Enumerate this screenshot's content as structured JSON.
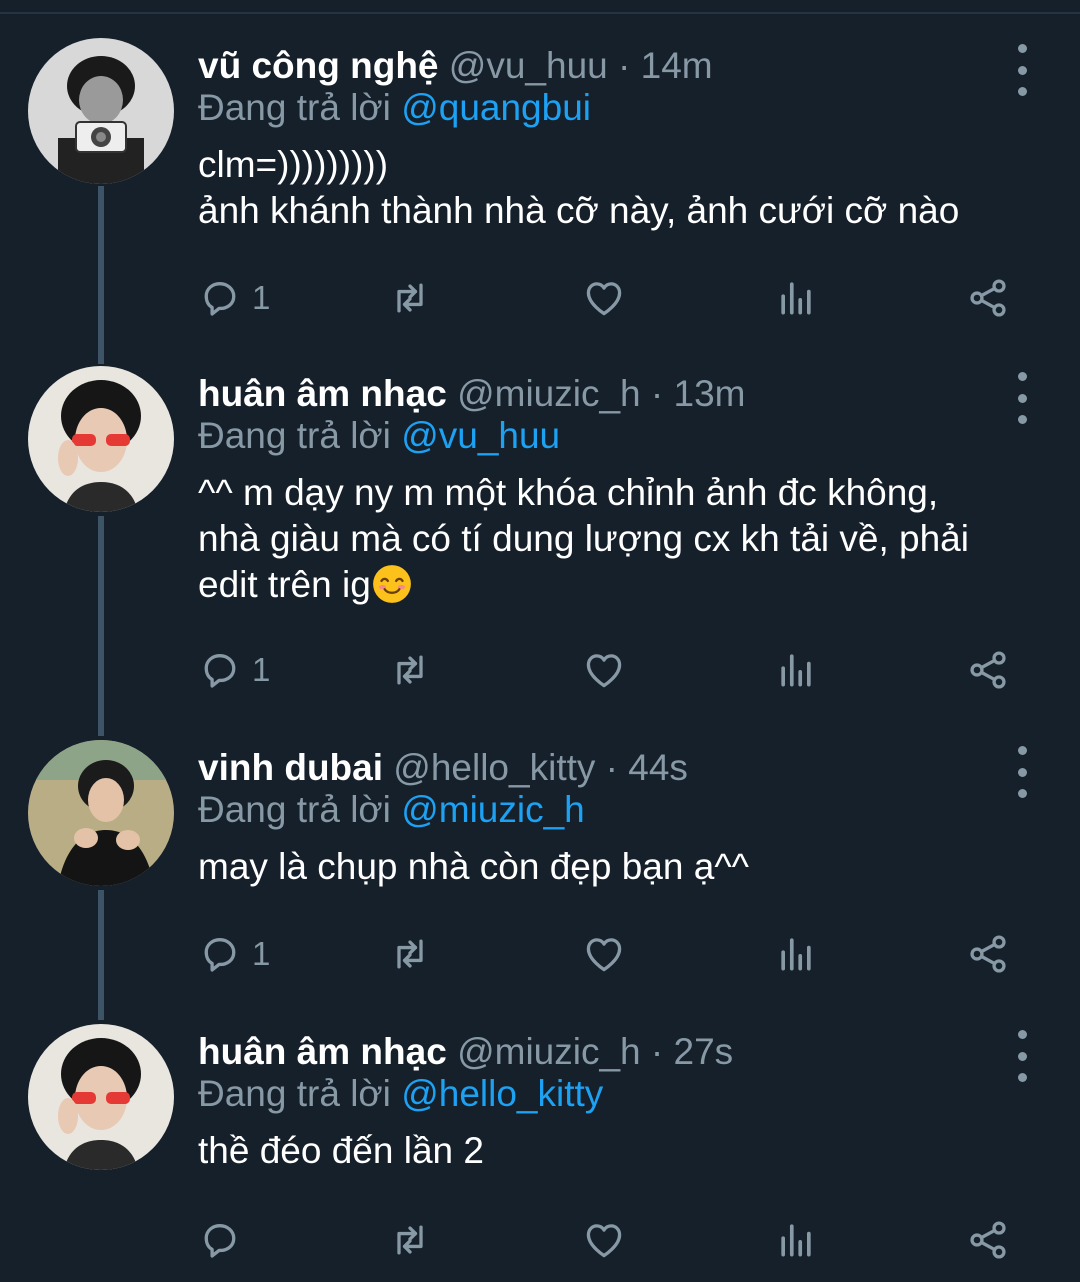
{
  "tweets": [
    {
      "name": "vũ công nghệ",
      "handle": "@vu_huu",
      "time": "14m",
      "reply_prefix": "Đang trả lời",
      "reply_to": "@quangbui",
      "lines": [
        "clm=)))))))))",
        "ảnh khánh thành nhà cỡ này, ảnh cưới cỡ nào"
      ],
      "reply_count": "1"
    },
    {
      "name": "huân âm nhạc",
      "handle": "@miuzic_h",
      "time": "13m",
      "reply_prefix": "Đang trả lời",
      "reply_to": "@vu_huu",
      "lines": [
        "^^ m dạy ny m một khóa chỉnh ảnh đc không,",
        "nhà giàu mà có tí dung lượng cx kh tải về, phải",
        "edit trên ig"
      ],
      "emoji": "smiling-face-emoji",
      "reply_count": "1"
    },
    {
      "name": "vinh dubai",
      "handle": "@hello_kitty",
      "time": "44s",
      "reply_prefix": "Đang trả lời",
      "reply_to": "@miuzic_h",
      "lines": [
        "may là chụp nhà còn đẹp bạn ạ^^"
      ],
      "reply_count": "1"
    },
    {
      "name": "huân âm nhạc",
      "handle": "@miuzic_h",
      "time": "27s",
      "reply_prefix": "Đang trả lời",
      "reply_to": "@hello_kitty",
      "lines": [
        "thề đéo đến lần 2"
      ],
      "reply_count": ""
    }
  ],
  "separator": "·",
  "icons": [
    "reply-icon",
    "retweet-icon",
    "like-icon",
    "analytics-icon",
    "share-icon",
    "more-icon"
  ],
  "colors": {
    "background": "#15202b",
    "text": "#ffffff",
    "secondary": "#8899a6",
    "link": "#1da1f2",
    "thread_line": "#3d5466"
  }
}
